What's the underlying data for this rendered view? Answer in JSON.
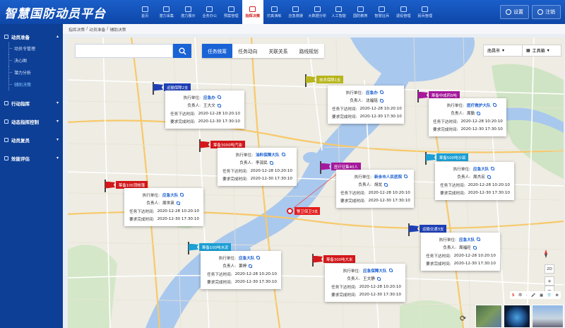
{
  "app": {
    "title": "智慧国防动员平台"
  },
  "nav": [
    {
      "label": "首页"
    },
    {
      "label": "潜力采集"
    },
    {
      "label": "潜力展示"
    },
    {
      "label": "业务办公"
    },
    {
      "label": "预案管理"
    },
    {
      "label": "指挥决策",
      "active": true
    },
    {
      "label": "仿真演练"
    },
    {
      "label": "应急救援"
    },
    {
      "label": "大数据分析"
    },
    {
      "label": "人工智能"
    },
    {
      "label": "国防教育"
    },
    {
      "label": "智慧征兵"
    },
    {
      "label": "退役管理"
    },
    {
      "label": "民兵管理"
    }
  ],
  "top_actions": {
    "settings": "设置",
    "logout": "注销"
  },
  "sidebar": {
    "sections": [
      {
        "label": "动员准备",
        "expanded": true,
        "items": [
          {
            "label": "动员令管理"
          },
          {
            "label": "决心图"
          },
          {
            "label": "潜力分析"
          },
          {
            "label": "辅助决策",
            "active": true
          }
        ]
      },
      {
        "label": "行动指挥"
      },
      {
        "label": "动态指挥控制"
      },
      {
        "label": "动员复员"
      },
      {
        "label": "效能评估"
      }
    ]
  },
  "breadcrumb": [
    "指挥决策",
    "动员准备",
    "辅助决策"
  ],
  "map": {
    "tabs": [
      {
        "label": "任务统筹",
        "active": true
      },
      {
        "label": "任务动向"
      },
      {
        "label": "关联关系"
      },
      {
        "label": "路线规划"
      }
    ],
    "city_select": "南昌市",
    "toolbox": "工具箱",
    "zoom": {
      "mode": "2D",
      "in": "+",
      "out": "−"
    },
    "map_tools": [
      "S",
      "中",
      "·",
      "🎤",
      "▦",
      "👕",
      "⚙"
    ],
    "pin": {
      "label": "警卫保卫3支"
    },
    "markers": [
      {
        "label": "运输保障2支",
        "color": "#1d3fb5",
        "unit": "应急办",
        "person": "王大文"
      },
      {
        "label": "筹备3000吨汽油",
        "color": "#d3171b",
        "unit": "油料保障大队",
        "person": "李润民"
      },
      {
        "label": "技术保障1支",
        "color": "#b7b51a",
        "unit": "应急办",
        "person": "沈福铭"
      },
      {
        "label": "筹备中成药5吨",
        "color": "#a6189c",
        "unit": "医疗救护大队",
        "person": "周勤"
      },
      {
        "label": "医疗征集40人",
        "color": "#a6189c",
        "unit": "新余市人民医院",
        "person": "胡龙"
      },
      {
        "label": "筹备500吨沙袋",
        "color": "#1b9fd4",
        "unit": "应急大队",
        "person": "周杰宏"
      },
      {
        "label": "筹备100顶帐篷",
        "color": "#d3171b",
        "unit": "应急大队",
        "person": "周世英"
      },
      {
        "label": "运输交通3支",
        "color": "#1d3fb5",
        "unit": "应急大队",
        "person": "周福旺"
      },
      {
        "label": "筹备100吨水泥",
        "color": "#1b9fd4",
        "unit": "应急大队",
        "person": "萧婷"
      },
      {
        "label": "筹备300吨大米",
        "color": "#d3171b",
        "unit": "应急保障大队",
        "person": "王文静"
      }
    ],
    "card_fields": {
      "unit": "执行单位:",
      "person": "负责人:",
      "issued": "任务下达时间:",
      "required": "要求完成时间:"
    },
    "card_times": {
      "issued": "2020-12-28  10:20:10",
      "required": "2020-12-30  17:30:10"
    }
  }
}
